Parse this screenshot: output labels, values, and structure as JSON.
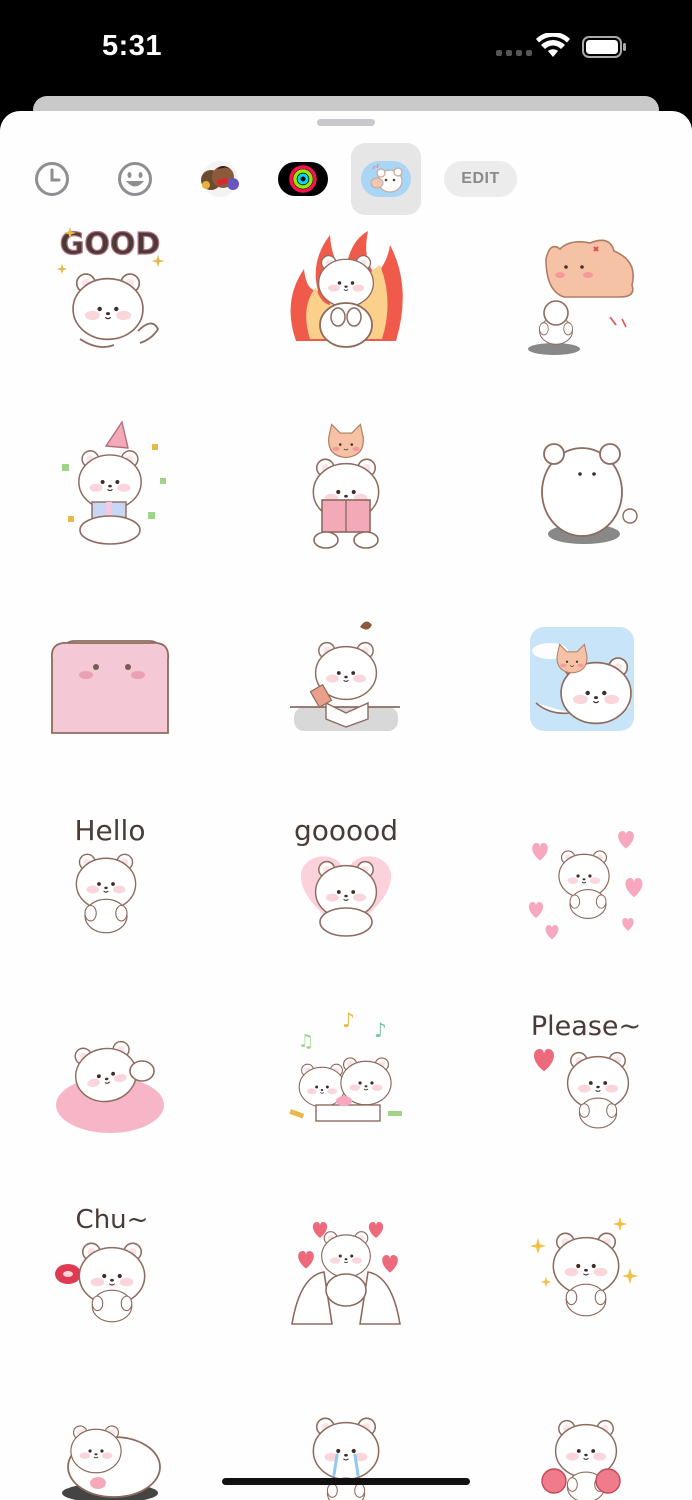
{
  "status_bar": {
    "time": "5:31"
  },
  "toolbar": {
    "items": [
      {
        "name": "recents-tab",
        "icon": "clock-icon"
      },
      {
        "name": "emoji-tab",
        "icon": "smiley-icon"
      },
      {
        "name": "memoji-stickers-tab",
        "icon": "memoji-icon"
      },
      {
        "name": "activity-stickers-tab",
        "icon": "activity-rings-icon"
      },
      {
        "name": "bear-stickers-tab",
        "icon": "bear-sticker-icon",
        "selected": true
      }
    ],
    "edit_label": "EDIT"
  },
  "stickers": {
    "captions": {
      "good": "GOOD",
      "hello": "Hello",
      "gooood": "gooood",
      "please": "Please~",
      "chu": "Chu~"
    },
    "items": [
      "good-bear",
      "fire-bear",
      "cat-angry-bear",
      "party-bear",
      "reading-bear",
      "shy-back-bear",
      "blanket-bear",
      "studying-bear",
      "cat-window-bear",
      "hello-bear",
      "gooood-heart-bear",
      "hearts-bear",
      "mochi-bear",
      "music-drawing-bears",
      "please-bear",
      "chu-bear",
      "love-hands-bear",
      "sparkle-bear",
      "lying-bear",
      "crying-bear",
      "pompom-bear"
    ]
  },
  "colors": {
    "accent_pink": "#f4a9b8",
    "outline": "#8d6b5e",
    "bear_fill": "#ffffff",
    "cat_fill": "#f5c2a6"
  }
}
